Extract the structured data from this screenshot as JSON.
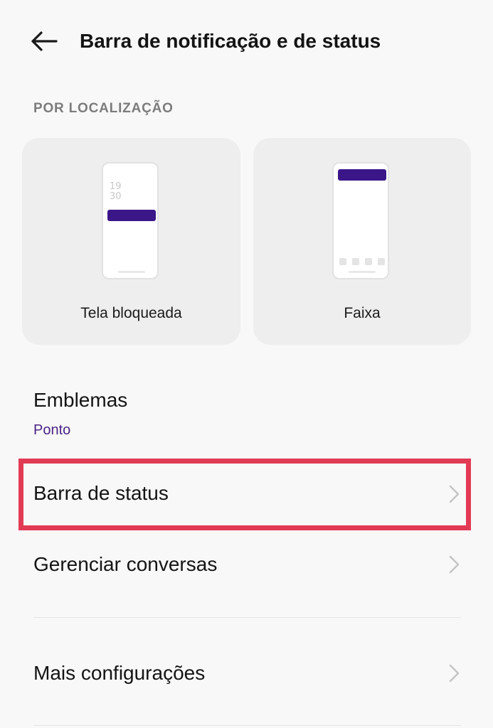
{
  "header": {
    "title": "Barra de notificação e de status",
    "back_icon": "arrow-left-icon"
  },
  "section": {
    "label": "POR LOCALIZAÇÃO"
  },
  "cards": [
    {
      "label": "Tela bloqueada",
      "preview_time_hour": "19",
      "preview_time_minute": "30"
    },
    {
      "label": "Faixa"
    }
  ],
  "settings": {
    "emblemas": {
      "title": "Emblemas",
      "value": "Ponto"
    },
    "barra_status": {
      "title": "Barra de status"
    },
    "gerenciar_conversas": {
      "title": "Gerenciar conversas"
    },
    "mais_config": {
      "title": "Mais configurações"
    }
  },
  "colors": {
    "accent": "#3b1689",
    "subtitle": "#4b2386",
    "highlight": "#e23a55",
    "background": "#f8f8f8",
    "card": "#eeeeee"
  }
}
